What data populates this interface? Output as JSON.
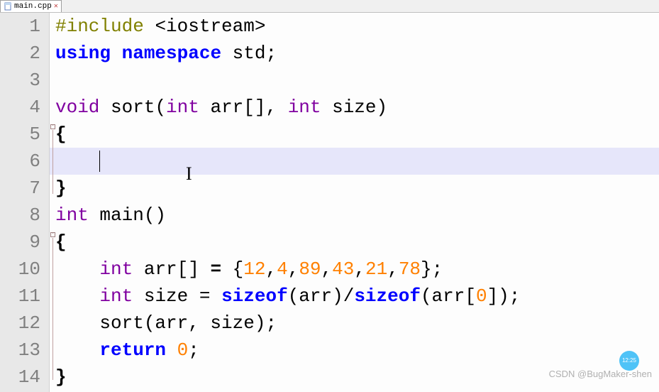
{
  "tab": {
    "filename": "main.cpp",
    "icon": "file-icon",
    "closeGlyph": "✕"
  },
  "lineNumbers": [
    "1",
    "2",
    "3",
    "4",
    "5",
    "6",
    "7",
    "8",
    "9",
    "10",
    "11",
    "12",
    "13",
    "14"
  ],
  "code": {
    "l1_include": "#include",
    "l1_header": "<iostream>",
    "l2_using": "using",
    "l2_ns": "namespace",
    "l2_std": "std;",
    "l4_void": "void",
    "l4_sort": "sort(",
    "l4_int1": "int",
    "l4_arr": " arr[], ",
    "l4_int2": "int",
    "l4_size": " size)",
    "l5_brace": "{",
    "l6_indent": "    ",
    "l7_brace": "}",
    "l8_int": "int",
    "l8_main": " main()",
    "l9_brace": "{",
    "l10_indent": "    ",
    "l10_int": "int",
    "l10_arr": " arr[] ",
    "l10_eq": "=",
    "l10_open": " {",
    "l10_n1": "12",
    "l10_c1": ",",
    "l10_n2": "4",
    "l10_c2": ",",
    "l10_n3": "89",
    "l10_c3": ",",
    "l10_n4": "43",
    "l10_c4": ",",
    "l10_n5": "21",
    "l10_c5": ",",
    "l10_n6": "78",
    "l10_close": "};",
    "l11_indent": "    ",
    "l11_int": "int",
    "l11_size": " size = ",
    "l11_sizeof1": "sizeof",
    "l11_arr1": "(arr)/",
    "l11_sizeof2": "sizeof",
    "l11_arr2": "(arr[",
    "l11_zero": "0",
    "l11_end": "]);",
    "l12_indent": "    sort(arr, size);",
    "l13_indent": "    ",
    "l13_return": "return",
    "l13_sp": " ",
    "l13_zero": "0",
    "l13_semi": ";",
    "l14_brace": "}"
  },
  "watermark": "CSDN @BugMaker-shen",
  "clockTime": "12:25",
  "cursorGlyph": "I"
}
